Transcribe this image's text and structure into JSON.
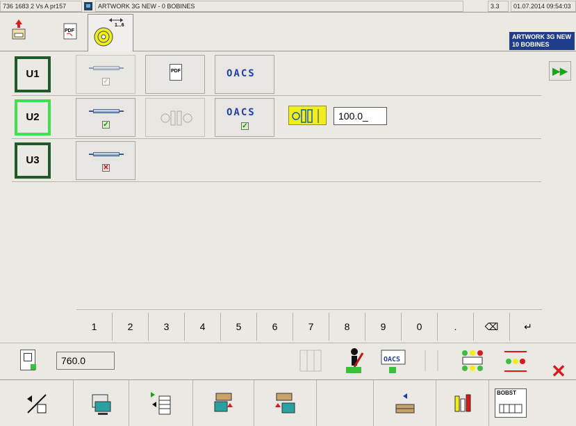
{
  "titlebar": {
    "machine_info": "736 1683 2 Vs A pr157",
    "job_title": "ARTWORK 3G NEW - 0 BOBINES",
    "version": "3.3",
    "datetime": "01.07.2014 09:54:03"
  },
  "toolbar": {
    "unwind_tab_label": "1...6",
    "job_label_line1": "ARTWORK 3G NEW",
    "job_label_line2": "10 BOBINES"
  },
  "units": [
    {
      "label": "U1",
      "state": "inactive",
      "sleeve_check": "disabled",
      "oacs_check": ""
    },
    {
      "label": "U2",
      "state": "active",
      "sleeve_check": "ok",
      "oacs_check": "ok"
    },
    {
      "label": "U3",
      "state": "inactive",
      "sleeve_check": "error"
    }
  ],
  "cells": {
    "pdf_text": "PDF",
    "oacs_text": "OACS"
  },
  "tension": {
    "value": "100.0_",
    "highlight_color": "#f1ee20"
  },
  "keypad": {
    "keys": [
      "1",
      "2",
      "3",
      "4",
      "5",
      "6",
      "7",
      "8",
      "9",
      "0",
      ".",
      "⌫",
      "↵"
    ]
  },
  "bottom": {
    "length_value": "760.0"
  },
  "colors": {
    "active_unit": "#3ee24a",
    "inactive_unit": "#1f5a2a",
    "oacs_blue": "#1f3fae",
    "close_red": "#d81a1a"
  },
  "nav": {
    "bobst_label": "BOBST"
  }
}
